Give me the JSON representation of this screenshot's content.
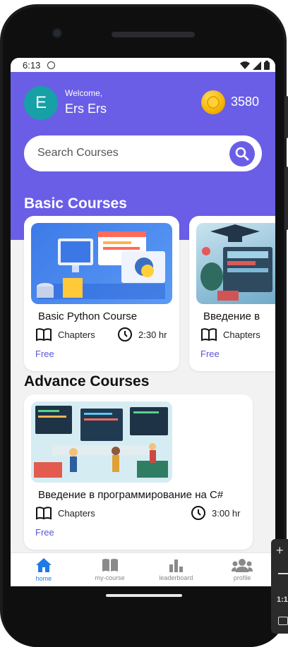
{
  "status_bar": {
    "time": "6:13"
  },
  "header": {
    "avatar_letter": "E",
    "welcome": "Welcome,",
    "username": "Ers Ers",
    "coins": "3580"
  },
  "search": {
    "placeholder": "Search Courses"
  },
  "basic_section": {
    "title": "Basic Courses",
    "courses": [
      {
        "title": "Basic Python Course",
        "chapters": "Chapters",
        "duration": "2:30 hr",
        "price": "Free"
      },
      {
        "title": "Введение в",
        "chapters": "Chapters",
        "price": "Free"
      }
    ]
  },
  "advance_section": {
    "title": "Advance Courses",
    "courses": [
      {
        "title": "Введение в программирование на C#",
        "chapters": "Chapters",
        "duration": "3:00 hr",
        "price": "Free"
      }
    ]
  },
  "bottom_nav": [
    {
      "label": "home",
      "icon": "home-icon",
      "active": true
    },
    {
      "label": "my-course",
      "icon": "book-icon",
      "active": false
    },
    {
      "label": "leaderboard",
      "icon": "bar-chart-icon",
      "active": false
    },
    {
      "label": "profile",
      "icon": "people-icon",
      "active": false
    }
  ],
  "emulator_toolbar": {
    "ratio_label": "1:1"
  },
  "colors": {
    "primary": "#6a5ee6",
    "avatar": "#17a0a5",
    "nav_active": "#1e7ae6",
    "free": "#5a56d9"
  }
}
